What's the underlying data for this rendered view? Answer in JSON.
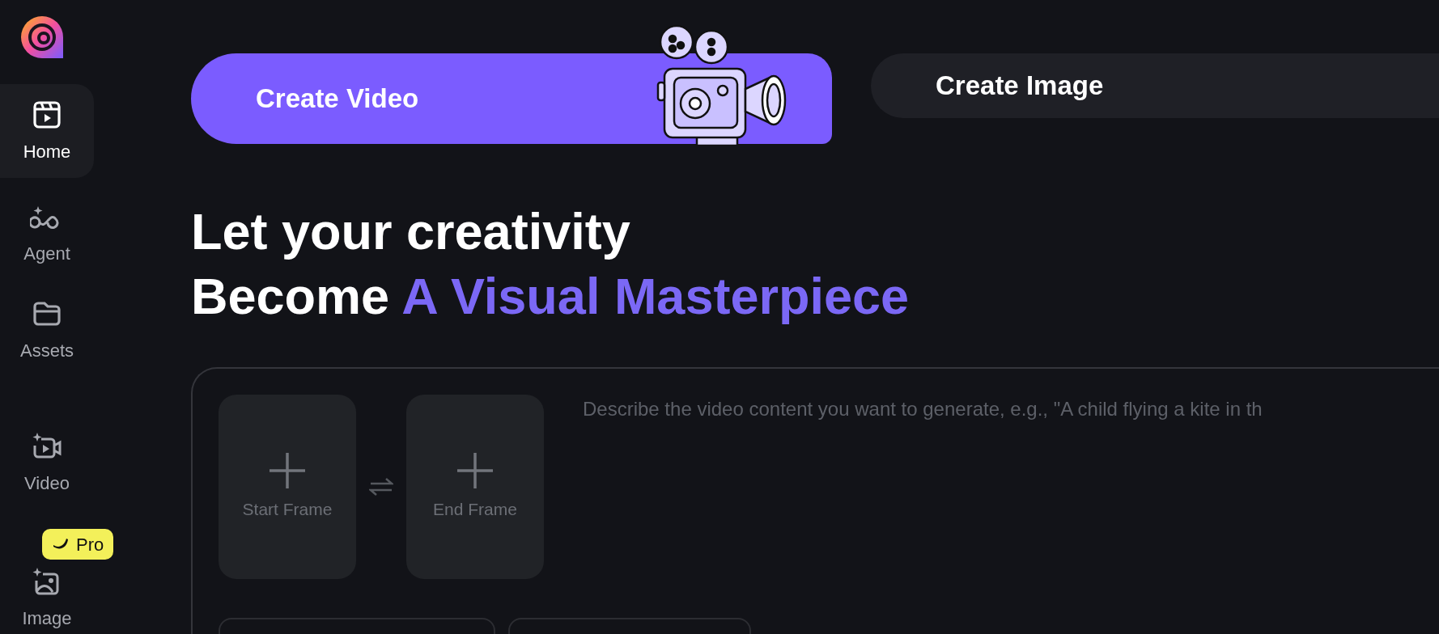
{
  "sidebar": {
    "items": [
      {
        "label": "Home",
        "selected": true
      },
      {
        "label": "Agent",
        "selected": false
      },
      {
        "label": "Assets",
        "selected": false
      },
      {
        "label": "Video",
        "selected": false
      },
      {
        "label": "Image",
        "selected": false,
        "badge": "Pro"
      }
    ]
  },
  "tabs": [
    {
      "label": "Create Video",
      "selected": true
    },
    {
      "label": "Create Image",
      "selected": false
    }
  ],
  "heading": {
    "line_1": "Let your creativity",
    "line_2": "Become **A Visual Masterpiece**"
  },
  "composer": {
    "frames": [
      {
        "label": "Start Frame"
      },
      {
        "label": "End Frame"
      }
    ],
    "prompt": {
      "placeholder": "Describe the video content you want to generate, e.g., \"A child flying a kite in th"
    }
  }
}
